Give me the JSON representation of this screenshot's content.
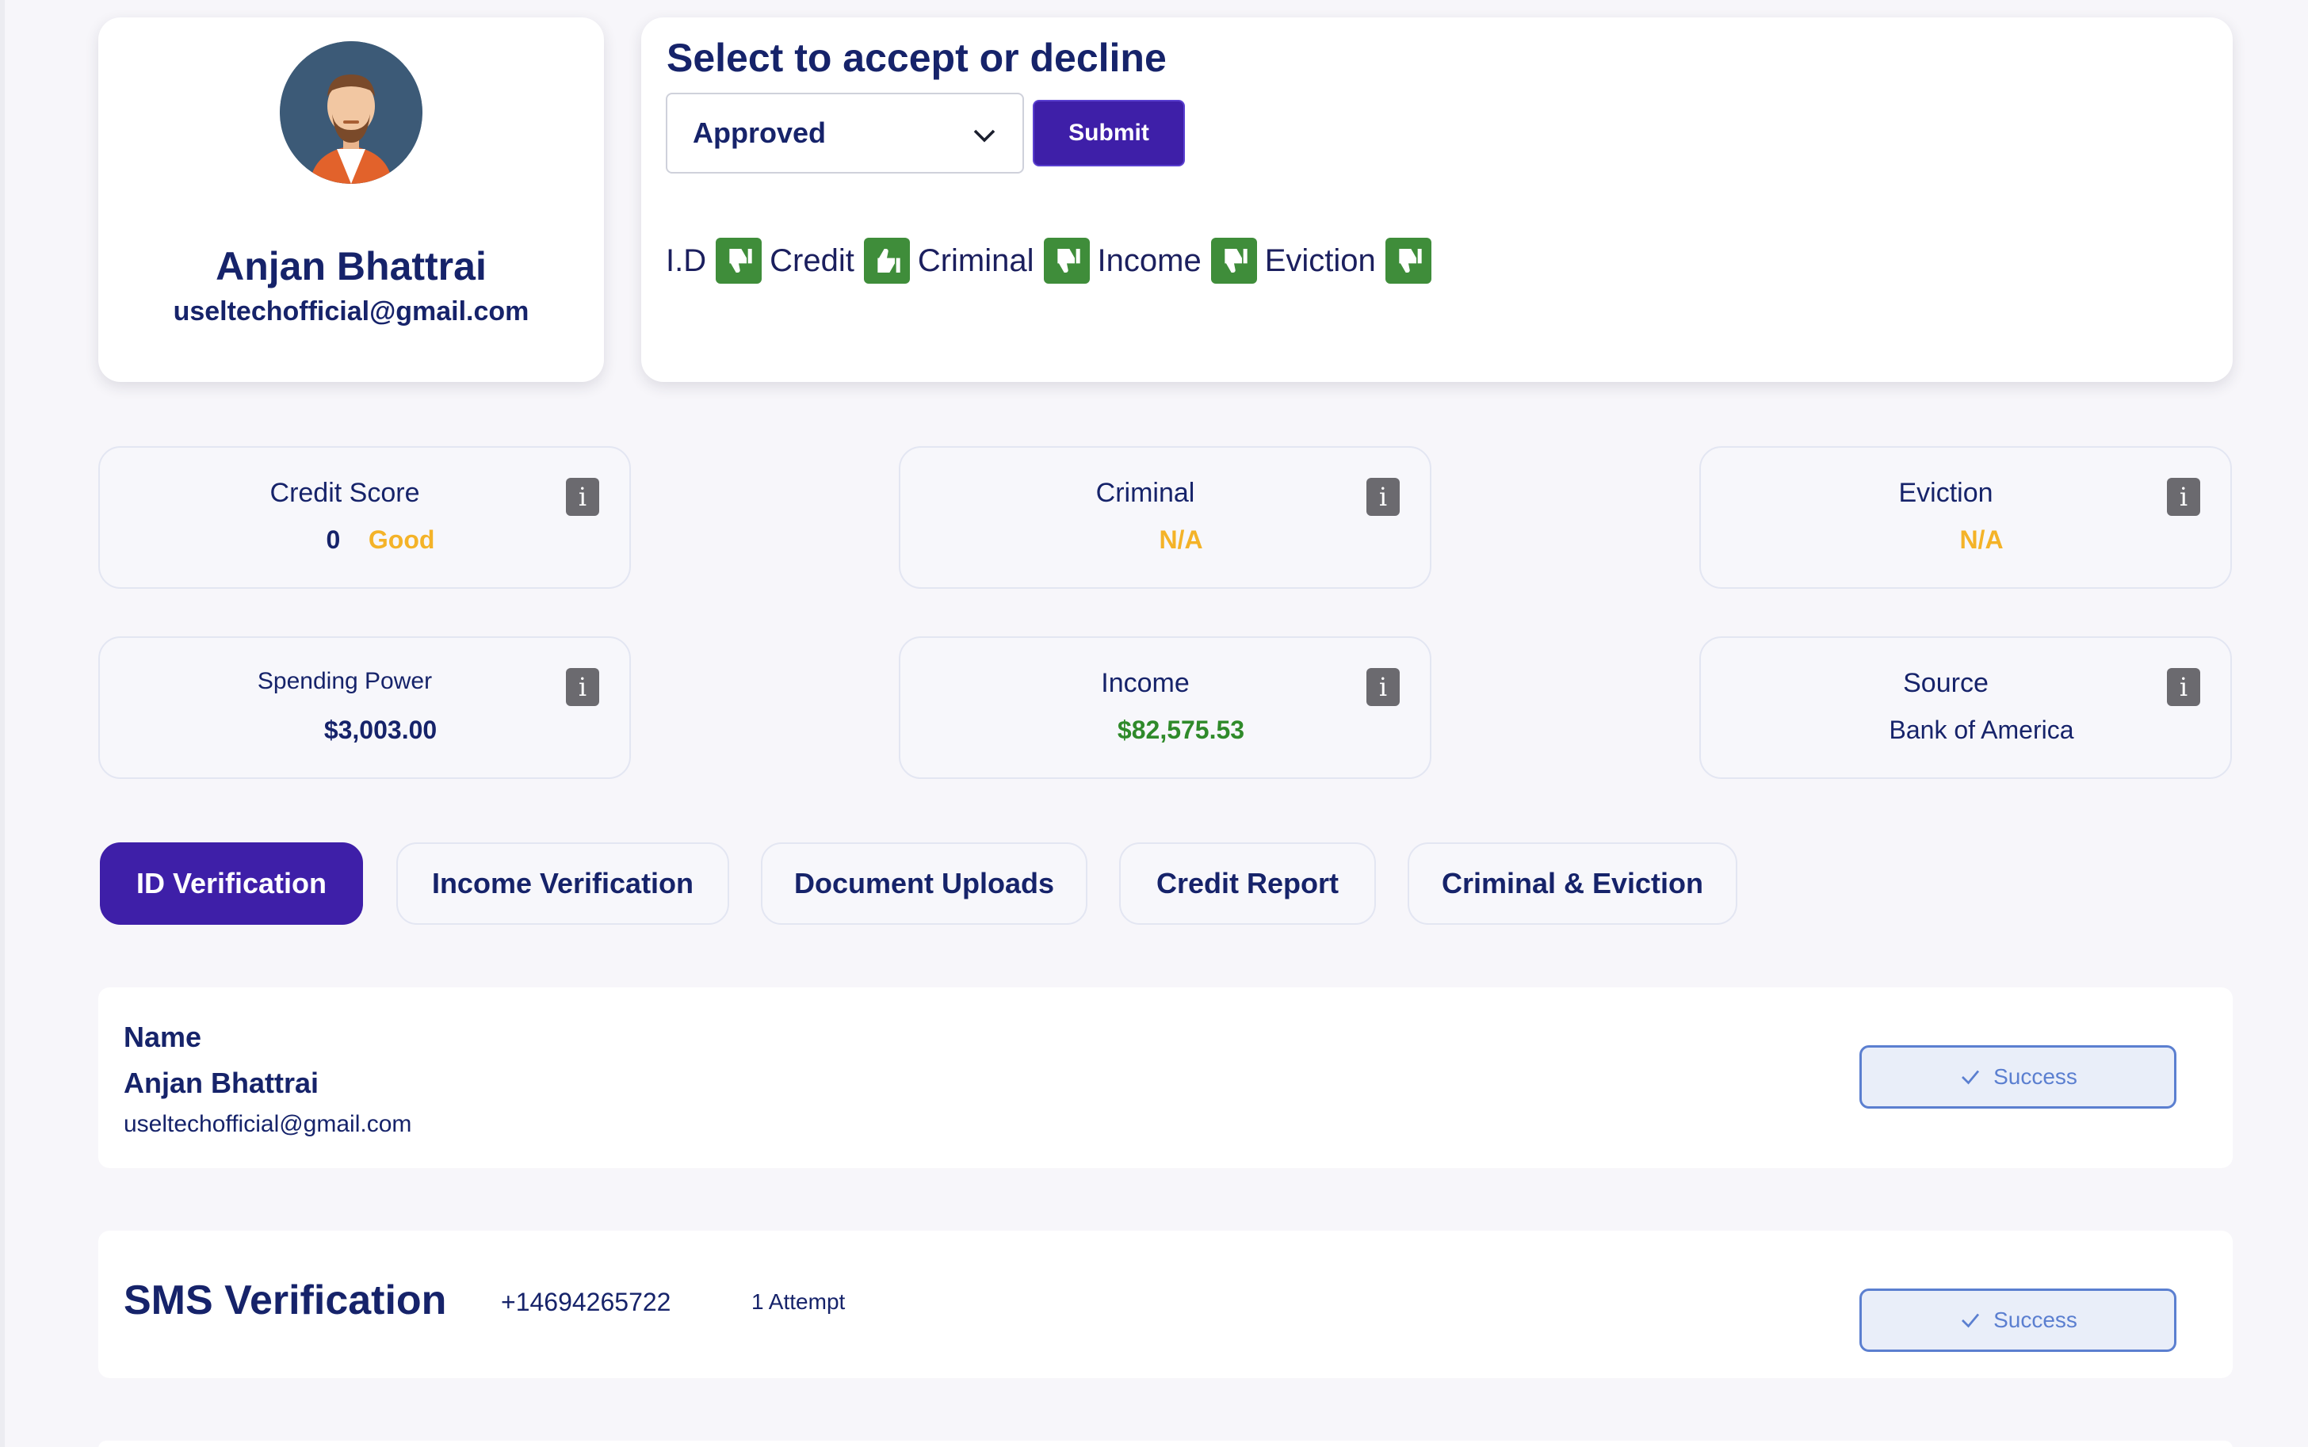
{
  "profile": {
    "name": "Anjan Bhattrai",
    "email": "useltechofficial@gmail.com"
  },
  "decision": {
    "title": "Select to accept or decline",
    "selected": "Approved",
    "submit_label": "Submit",
    "checks": [
      {
        "label": "I.D",
        "status": "thumbs-down-icon"
      },
      {
        "label": "Credit",
        "status": "thumbs-up-icon"
      },
      {
        "label": "Criminal",
        "status": "thumbs-down-icon"
      },
      {
        "label": "Income",
        "status": "thumbs-down-icon"
      },
      {
        "label": "Eviction",
        "status": "thumbs-down-icon"
      }
    ]
  },
  "stats": {
    "credit_score": {
      "label": "Credit Score",
      "value": "0",
      "rating": "Good"
    },
    "criminal": {
      "label": "Criminal",
      "value": "N/A"
    },
    "eviction": {
      "label": "Eviction",
      "value": "N/A"
    },
    "spending_power": {
      "label": "Spending Power",
      "value": "$3,003.00"
    },
    "income": {
      "label": "Income",
      "value": "$82,575.53"
    },
    "source": {
      "label": "Source",
      "value": "Bank of America"
    },
    "info_glyph": "i"
  },
  "tabs": [
    {
      "label": "ID Verification",
      "active": true
    },
    {
      "label": "Income Verification",
      "active": false
    },
    {
      "label": "Document Uploads",
      "active": false
    },
    {
      "label": "Credit Report",
      "active": false
    },
    {
      "label": "Criminal & Eviction",
      "active": false
    }
  ],
  "id_verification": {
    "field_label": "Name",
    "name": "Anjan Bhattrai",
    "email": "useltechofficial@gmail.com",
    "status": "Success"
  },
  "sms_verification": {
    "title": "SMS Verification",
    "phone": "+14694265722",
    "attempts": "1 Attempt",
    "status": "Success"
  },
  "colors": {
    "primary": "#3e1fa8",
    "navy": "#16236a",
    "thumb_green": "#3f8d3a",
    "warning": "#f4b328",
    "money_green": "#2f8a2a",
    "success_blue": "#5b7fd0"
  }
}
